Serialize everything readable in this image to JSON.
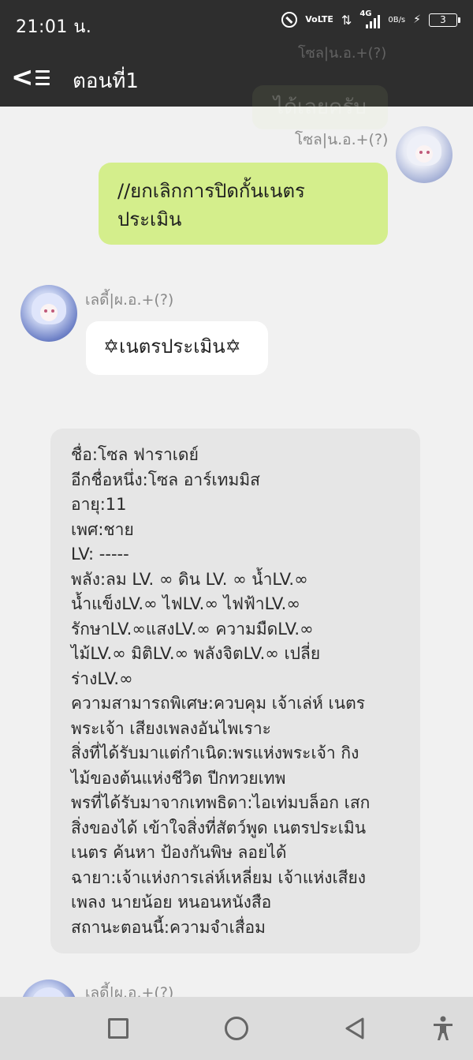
{
  "status_bar": {
    "time": "21:01 น.",
    "volte_top": "Vo",
    "volte_bottom": "LTE",
    "network": "4G",
    "speed_value": "0",
    "speed_unit": "B/s",
    "battery": "3"
  },
  "app_bar": {
    "title": "ตอนที่1"
  },
  "ghost_overlay": {
    "name_fragment": "โซล|น.อ.+(?)",
    "bubble_text": "ได้เลยครับ"
  },
  "messages": [
    {
      "sender": "โซล|น.อ.+(?)",
      "side": "right",
      "lines": [
        "//ยกเลิกการปิดกั้นเนตร",
        "ประเมิน"
      ]
    },
    {
      "sender": "เลดี้|ผ.อ.+(?)",
      "side": "left",
      "text": "✡เนตรประเมิน✡"
    },
    {
      "side": "left",
      "lines": [
        "ชื่อ:โซล ฟาราเดย์",
        "อีกชื่อหนึ่ง:โซล อาร์เทมมิส",
        "อายุ:11",
        "เพศ:ชาย",
        "LV: -----",
        "พลัง:ลม LV. ∞ ดิน LV. ∞ น้ำLV.∞",
        "น้ำแข็งLV.∞ ไฟLV.∞ ไฟฟ้าLV.∞",
        "รักษาLV.∞แสงLV.∞ ความมืดLV.∞",
        "ไม้LV.∞ มิติLV.∞ พลังจิตLV.∞ เปลี่ย",
        "ร่างLV.∞",
        "ความสามารถพิเศษ:ควบคุม เจ้าเล่ห์ เนตร",
        "พระเจ้า เสียงเพลงอันไพเราะ",
        "สิ่งที่ได้รับมาแต่กำเนิด:พรแห่งพระเจ้า กิง",
        "ไม้ของต้นแห่งชีวิต ปีกทวยเทพ",
        "พรที่ได้รับมาจากเทพธิดา:ไอเท่มบล็อก เสก",
        "สิ่งของได้ เข้าใจสิ่งที่สัตว์พูด เนตรประเมิน",
        "เนตร ค้นหา ป้องกันพิษ ลอยได้",
        "ฉายา:เจ้าแห่งการเล่ห์เหลี่ยม เจ้าแห่งเสียง",
        "เพลง นายน้อย หนอนหนังสือ",
        "สถานะตอนนี้:ความจำเสื่อม"
      ]
    },
    {
      "sender": "เลดี้|ผ.อ.+(?)",
      "side": "left"
    }
  ],
  "icons": {
    "back": "back-menu-icon",
    "nav_recent": "square-icon",
    "nav_home": "circle-icon",
    "nav_back": "triangle-back-icon",
    "accessibility": "accessibility-icon"
  },
  "colors": {
    "bar_bg": "#2e2e2e",
    "chat_bg": "#f1f1f1",
    "bubble_green": "#d4ee8c",
    "bubble_white": "#ffffff",
    "bubble_grey": "#e6e6e6",
    "nav_bg": "#dcdcdc"
  }
}
